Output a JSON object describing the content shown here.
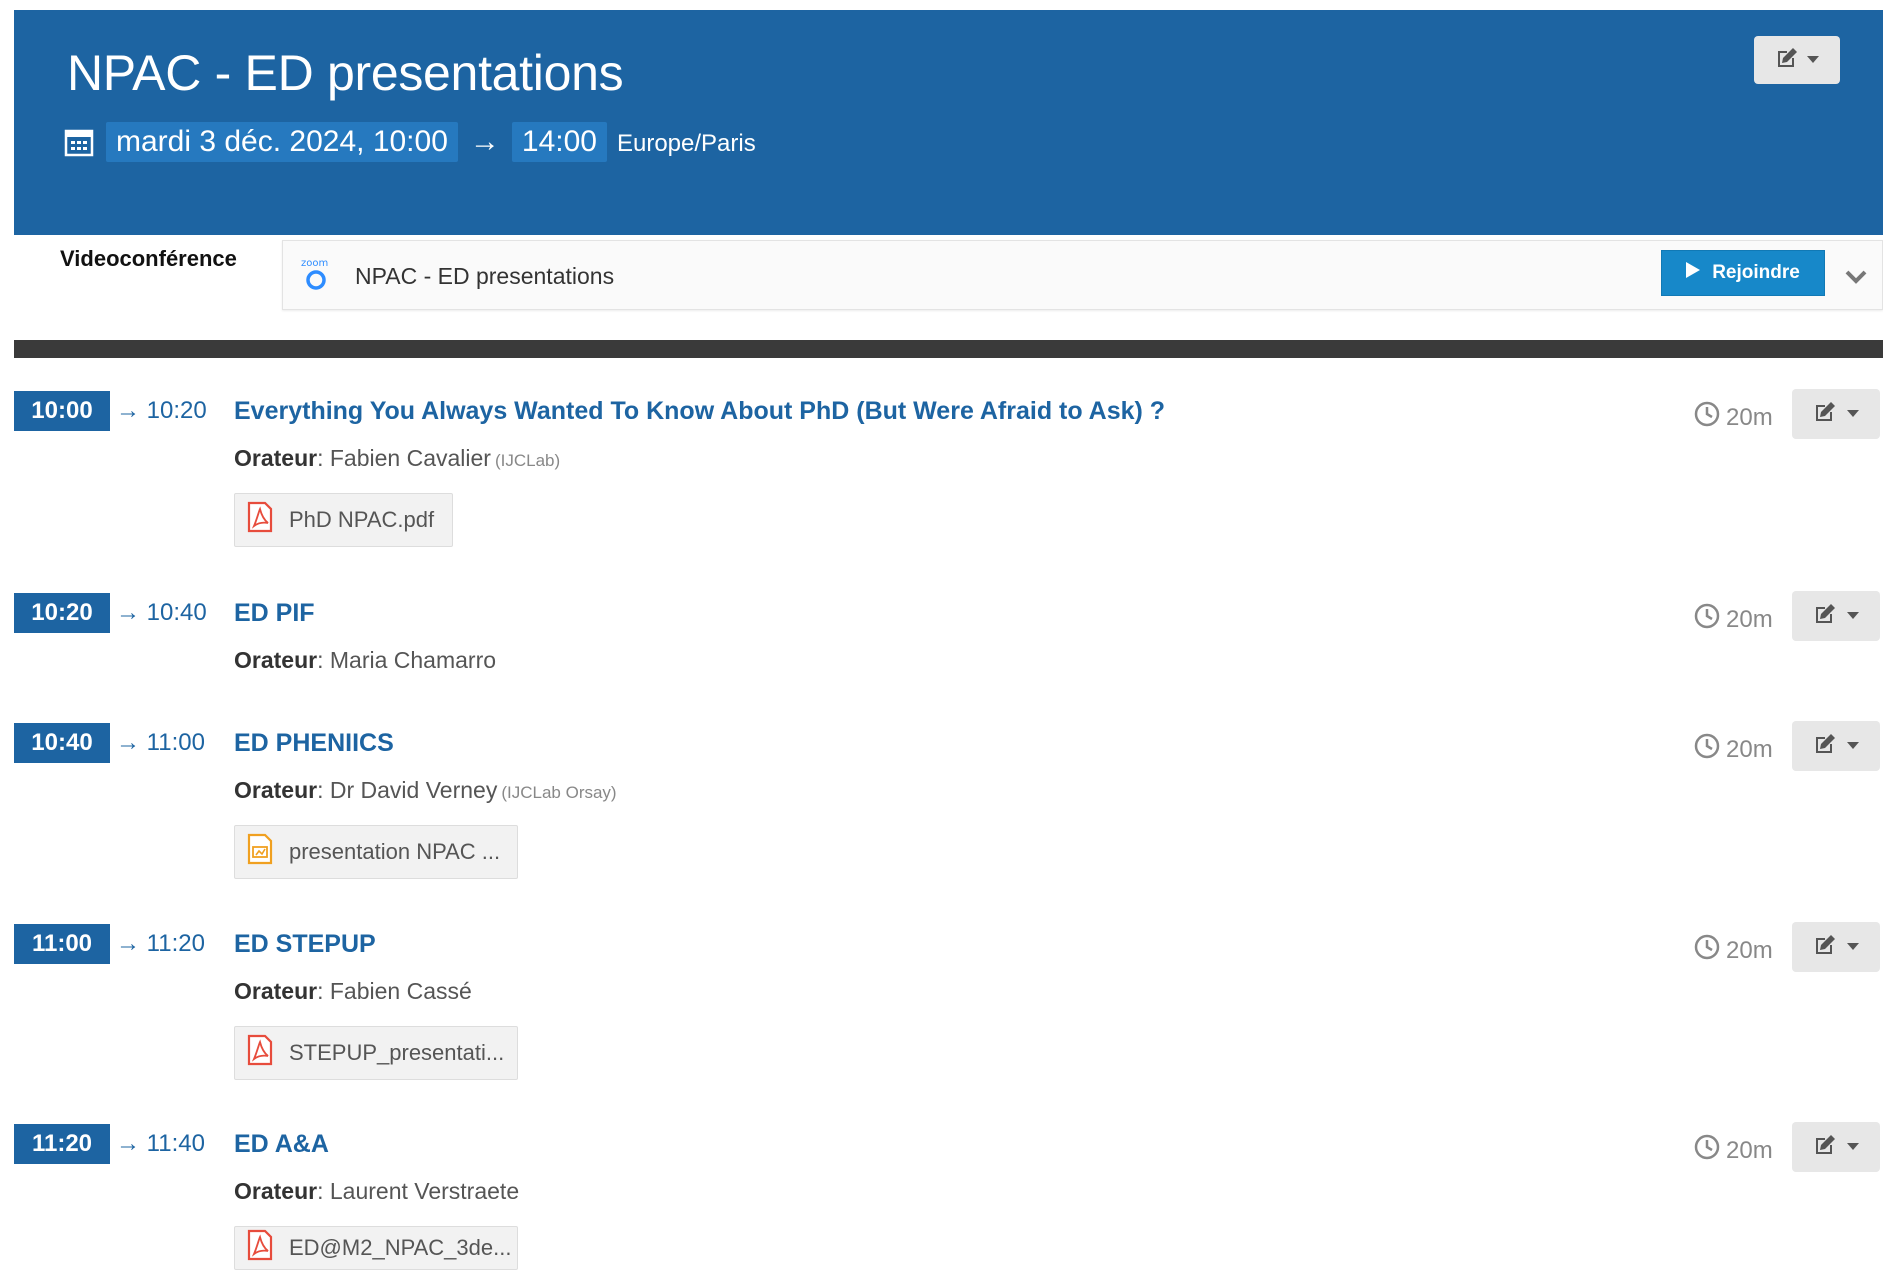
{
  "header": {
    "title": "NPAC - ED presentations",
    "date_start": "mardi 3 déc. 2024, 10:00",
    "date_arrow": "→",
    "date_end": "14:00",
    "timezone": "Europe/Paris",
    "background_color": "#1d64a2",
    "icons": {
      "calendar": "calendar-icon",
      "edit": "edit-icon",
      "caret": "caret-down-icon"
    }
  },
  "videoconference": {
    "label": "Videoconférence",
    "provider_logo": "zoom",
    "room_title": "NPAC - ED presentations",
    "join_label": "Rejoindre",
    "join_color": "#1788c9",
    "icons": {
      "join": "play-icon",
      "toggle": "chevron-down-icon"
    }
  },
  "timetable": {
    "speaker_label": "Orateur",
    "arrow": "→",
    "contributions": [
      {
        "start": "10:00",
        "end": "10:20",
        "title": "Everything You Always Wanted To Know About PhD (But Were Afraid to Ask) ?",
        "speaker": "Fabien Cavalier",
        "affiliation": "(IJCLab)",
        "duration": "20m",
        "attachment": {
          "name": "PhD NPAC.pdf",
          "type": "pdf"
        }
      },
      {
        "start": "10:20",
        "end": "10:40",
        "title": "ED PIF",
        "speaker": "Maria Chamarro",
        "affiliation": "",
        "duration": "20m",
        "attachment": null
      },
      {
        "start": "10:40",
        "end": "11:00",
        "title": "ED PHENIICS",
        "speaker": "Dr David Verney",
        "affiliation": "(IJCLab Orsay)",
        "duration": "20m",
        "attachment": {
          "name": "presentation NPAC ...",
          "type": "presentation"
        }
      },
      {
        "start": "11:00",
        "end": "11:20",
        "title": "ED STEPUP",
        "speaker": "Fabien Cassé",
        "affiliation": "",
        "duration": "20m",
        "attachment": {
          "name": "STEPUP_presentati...",
          "type": "pdf"
        }
      },
      {
        "start": "11:20",
        "end": "11:40",
        "title": "ED A&A",
        "speaker": "Laurent Verstraete",
        "affiliation": "",
        "duration": "20m",
        "attachment": {
          "name": "ED@M2_NPAC_3de...",
          "type": "pdf"
        }
      }
    ]
  }
}
